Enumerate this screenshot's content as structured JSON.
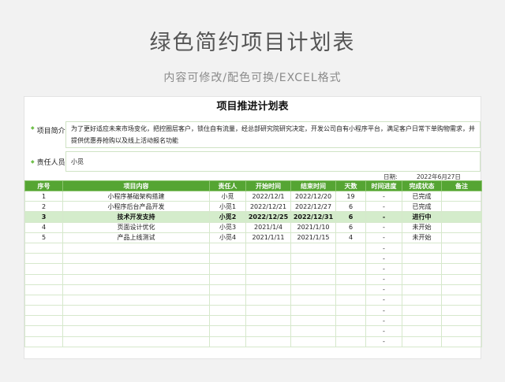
{
  "banner": {
    "title": "绿色简约项目计划表",
    "subtitle": "内容可修改/配色可换/EXCEL格式"
  },
  "sheet": {
    "title": "项目推进计划表",
    "intro_label": "项目简介",
    "intro_text": "为了更好适应未来市场变化，把控圈层客户，锁住自有流量，经总部研究院研究决定，开发公司自有小程序平台，满足客户日常下单购物需求，并提供优惠券抢购以及线上活动报名功能",
    "owner_label": "责任人员",
    "owner_value": "小觅",
    "date_label": "日期:",
    "date_value": "2022年6月27日",
    "columns": [
      "序号",
      "项目内容",
      "责任人",
      "开始时间",
      "结束时间",
      "天数",
      "时间进度",
      "完成状态",
      "备注"
    ],
    "rows": [
      {
        "no": "1",
        "task": "小程序基础架构搭建",
        "owner": "小觅",
        "start": "2022/12/1",
        "end": "2022/12/20",
        "days": "19",
        "progress": "-",
        "status": "已完成",
        "note": "",
        "active": false
      },
      {
        "no": "2",
        "task": "小程序后台产品开发",
        "owner": "小觅1",
        "start": "2022/12/21",
        "end": "2022/12/27",
        "days": "6",
        "progress": "-",
        "status": "已完成",
        "note": "",
        "active": false
      },
      {
        "no": "3",
        "task": "技术开发支持",
        "owner": "小觅2",
        "start": "2022/12/25",
        "end": "2022/12/31",
        "days": "6",
        "progress": "-",
        "status": "进行中",
        "note": "",
        "active": true
      },
      {
        "no": "4",
        "task": "页面设计优化",
        "owner": "小觅3",
        "start": "2021/1/4",
        "end": "2021/1/10",
        "days": "6",
        "progress": "-",
        "status": "未开始",
        "note": "",
        "active": false
      },
      {
        "no": "5",
        "task": "产品上线测试",
        "owner": "小觅4",
        "start": "2021/1/11",
        "end": "2021/1/15",
        "days": "4",
        "progress": "-",
        "status": "未开始",
        "note": "",
        "active": false
      },
      {
        "no": "",
        "task": "",
        "owner": "",
        "start": "",
        "end": "",
        "days": "",
        "progress": "-",
        "status": "",
        "note": "",
        "active": false
      },
      {
        "no": "",
        "task": "",
        "owner": "",
        "start": "",
        "end": "",
        "days": "",
        "progress": "-",
        "status": "",
        "note": "",
        "active": false
      },
      {
        "no": "",
        "task": "",
        "owner": "",
        "start": "",
        "end": "",
        "days": "",
        "progress": "-",
        "status": "",
        "note": "",
        "active": false
      },
      {
        "no": "",
        "task": "",
        "owner": "",
        "start": "",
        "end": "",
        "days": "",
        "progress": "-",
        "status": "",
        "note": "",
        "active": false
      },
      {
        "no": "",
        "task": "",
        "owner": "",
        "start": "",
        "end": "",
        "days": "",
        "progress": "-",
        "status": "",
        "note": "",
        "active": false
      },
      {
        "no": "",
        "task": "",
        "owner": "",
        "start": "",
        "end": "",
        "days": "",
        "progress": "-",
        "status": "",
        "note": "",
        "active": false
      },
      {
        "no": "",
        "task": "",
        "owner": "",
        "start": "",
        "end": "",
        "days": "",
        "progress": "-",
        "status": "",
        "note": "",
        "active": false
      },
      {
        "no": "",
        "task": "",
        "owner": "",
        "start": "",
        "end": "",
        "days": "",
        "progress": "-",
        "status": "",
        "note": "",
        "active": false
      },
      {
        "no": "",
        "task": "",
        "owner": "",
        "start": "",
        "end": "",
        "days": "",
        "progress": "-",
        "status": "",
        "note": "",
        "active": false
      },
      {
        "no": "",
        "task": "",
        "owner": "",
        "start": "",
        "end": "",
        "days": "",
        "progress": "-",
        "status": "",
        "note": "",
        "active": false
      }
    ]
  },
  "colors": {
    "header_green": "#55a533",
    "active_row": "#d4eccb",
    "bullet_green": "#6fbf4a"
  },
  "icons": {
    "section_bullet": "bullet-dot-icon"
  }
}
